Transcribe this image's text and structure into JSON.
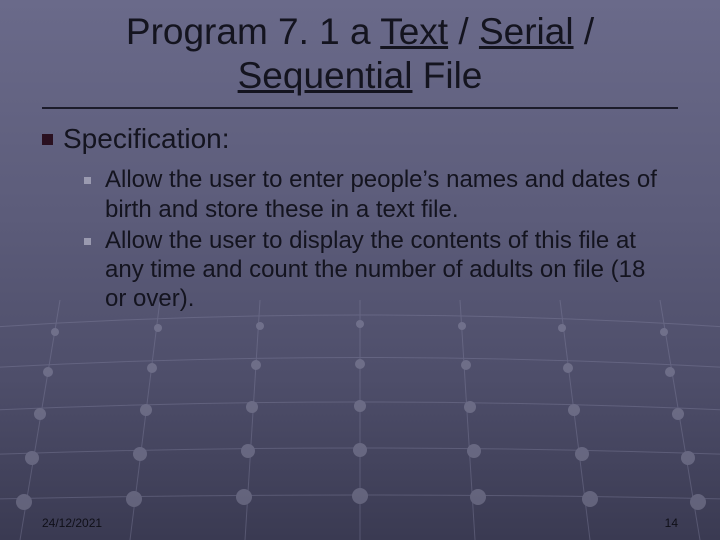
{
  "title": {
    "prefix": "Program 7. 1 a ",
    "u1": "Text",
    "sep1": " / ",
    "u2": "Serial",
    "sep2": " / ",
    "line2_u": "Sequential",
    "line2_rest": " File"
  },
  "spec_label": "Specification:",
  "bullets": [
    "Allow the user to enter people’s names and dates of birth and store these in a text file.",
    "Allow the user to display the contents of this file at any time and count the number of adults on file (18 or over)."
  ],
  "footer": {
    "date": "24/12/2021",
    "page": "14"
  }
}
